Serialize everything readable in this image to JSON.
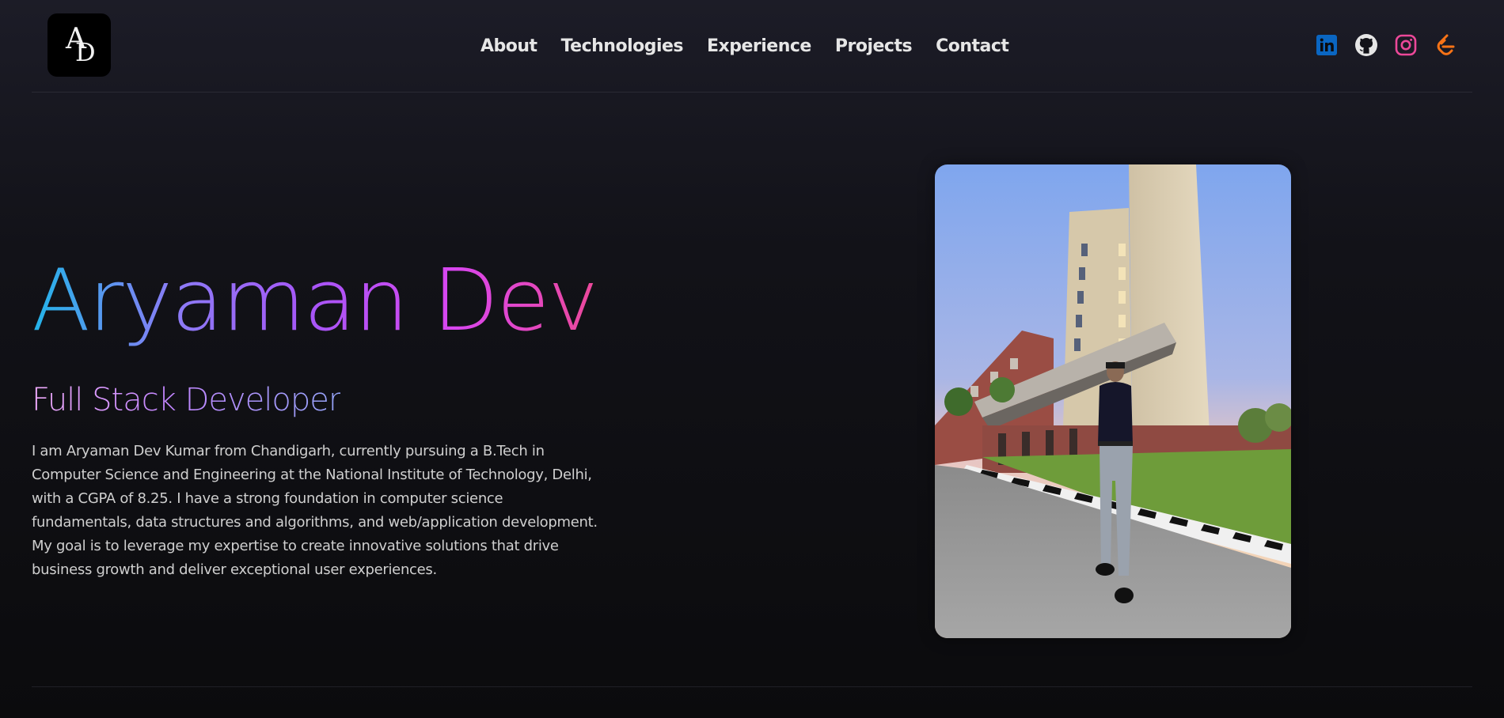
{
  "logo": {
    "text_top": "A",
    "text_bottom": "D"
  },
  "nav": {
    "items": [
      {
        "label": "About"
      },
      {
        "label": "Technologies"
      },
      {
        "label": "Experience"
      },
      {
        "label": "Projects"
      },
      {
        "label": "Contact"
      }
    ]
  },
  "social": [
    {
      "icon": "linkedin-icon",
      "color": "#0a66c2"
    },
    {
      "icon": "github-icon",
      "color": "#e6e6e6"
    },
    {
      "icon": "instagram-icon",
      "color": "#e1306c"
    },
    {
      "icon": "leetcode-icon",
      "color": "#f97316"
    }
  ],
  "hero": {
    "name": "Aryaman Dev",
    "role": "Full Stack Developer",
    "description": "I am Aryaman Dev Kumar from Chandigarh, currently pursuing a B.Tech in Computer Science and Engineering at the National Institute of Technology, Delhi, with a CGPA of 8.25. I have a strong foundation in computer science fundamentals, data structures and algorithms, and web/application development. My goal is to leverage my expertise to create innovative solutions that drive business growth and deliver exceptional user experiences."
  },
  "colors": {
    "gradient_start": "#22b4e8",
    "gradient_mid": "#a855f7",
    "gradient_end": "#ec4899",
    "background": "#0b0b0d"
  }
}
